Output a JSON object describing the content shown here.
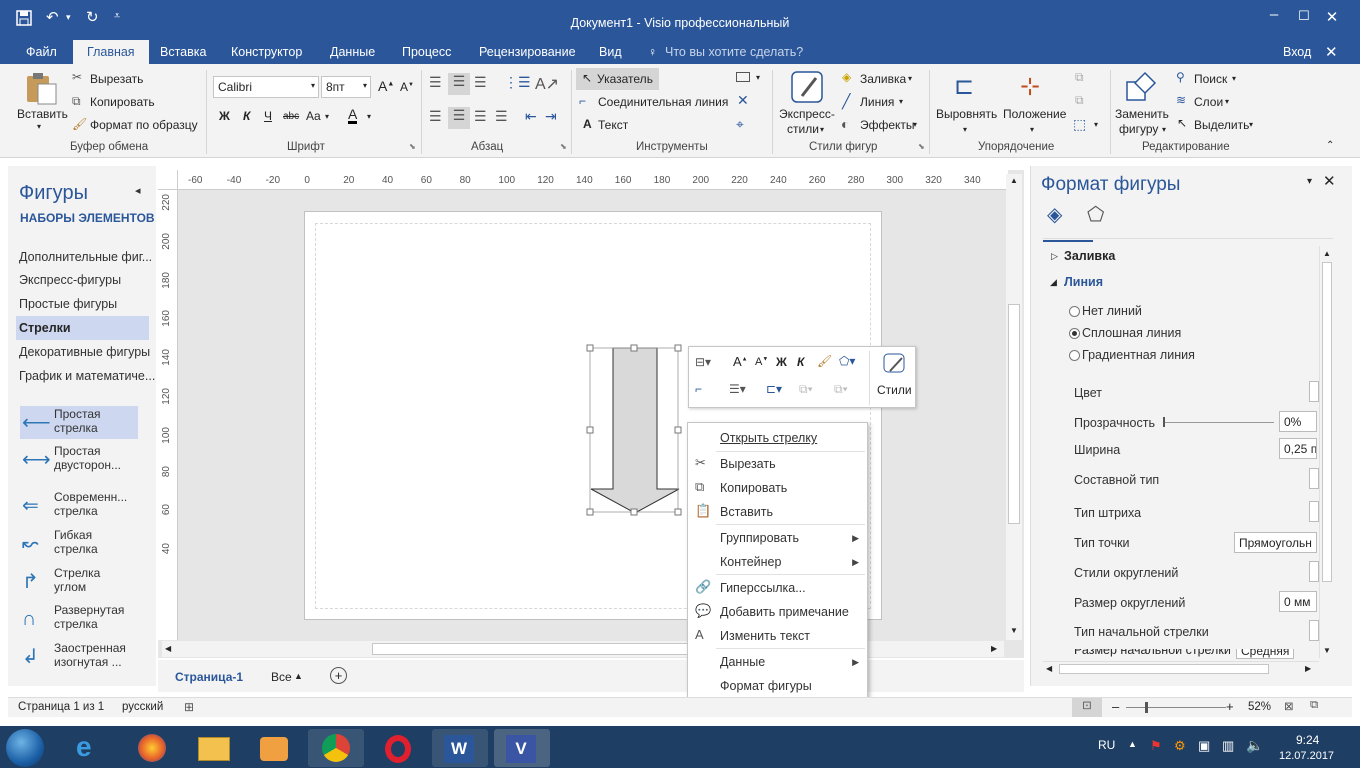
{
  "window": {
    "title": "Документ1 - Visio профессиональный",
    "minimize": "–",
    "maximize": "☐",
    "close": "✕"
  },
  "quick_access": {
    "save": "save-icon",
    "undo": "undo-icon",
    "redo": "redo-icon",
    "customize": "customize-icon"
  },
  "tabs": [
    {
      "label": "Файл"
    },
    {
      "label": "Главная"
    },
    {
      "label": "Вставка"
    },
    {
      "label": "Конструктор"
    },
    {
      "label": "Данные"
    },
    {
      "label": "Процесс"
    },
    {
      "label": "Рецензирование"
    },
    {
      "label": "Вид"
    }
  ],
  "tell_me": "Что вы хотите сделать?",
  "signin": "Вход",
  "ribbon": {
    "clipboard": {
      "paste": "Вставить",
      "cut": "Вырезать",
      "copy": "Копировать",
      "format_painter": "Формат по образцу",
      "label": "Буфер обмена"
    },
    "font": {
      "name": "Calibri",
      "size": "8пт",
      "bold": "Ж",
      "italic": "К",
      "underline": "Ч",
      "strike": "abc",
      "case": "Aa",
      "label": "Шрифт"
    },
    "paragraph": {
      "label": "Абзац"
    },
    "tools": {
      "pointer": "Указатель",
      "connector": "Соединительная линия",
      "text": "Текст",
      "label": "Инструменты"
    },
    "shape_styles": {
      "express": "Экспресс-",
      "express2": "стили",
      "fill": "Заливка",
      "line": "Линия",
      "effects": "Эффекты",
      "label": "Стили фигур"
    },
    "arrange": {
      "align": "Выровнять",
      "position": "Положение",
      "label": "Упорядочение"
    },
    "editing": {
      "replace": "Заменить",
      "replace2": "фигуру",
      "find": "Поиск",
      "layers": "Слои",
      "select": "Выделить",
      "label": "Редактирование"
    }
  },
  "shapes_pane": {
    "title": "Фигуры",
    "sets_header": "НАБОРЫ ЭЛЕМЕНТОВ",
    "items": [
      {
        "label": "Дополнительные фиг..."
      },
      {
        "label": "Экспресс-фигуры"
      },
      {
        "label": "Простые фигуры"
      },
      {
        "label": "Стрелки"
      },
      {
        "label": "Декоративные фигуры"
      },
      {
        "label": "График и математиче..."
      }
    ],
    "stencils": [
      {
        "l1": "Простая",
        "l2": "стрелка",
        "icon": "arrow-left-icon"
      },
      {
        "l1": "Простая",
        "l2": "двусторон...",
        "icon": "arrow-both-icon"
      },
      {
        "l1": "Современн...",
        "l2": "стрелка",
        "icon": "arrow-modern-icon"
      },
      {
        "l1": "Гибкая",
        "l2": "стрелка",
        "icon": "arrow-flex-icon"
      },
      {
        "l1": "Стрелка",
        "l2": "углом",
        "icon": "arrow-corner-icon"
      },
      {
        "l1": "Развернутая",
        "l2": "стрелка",
        "icon": "arrow-uturn-icon"
      },
      {
        "l1": "Заостренная",
        "l2": "изогнутая ...",
        "icon": "arrow-bent-icon"
      }
    ]
  },
  "ruler_h": [
    "-60",
    "-40",
    "-20",
    "0",
    "20",
    "40",
    "60",
    "80",
    "100",
    "120",
    "140",
    "160",
    "180",
    "200",
    "220",
    "240",
    "260",
    "280",
    "300",
    "320",
    "340"
  ],
  "ruler_v": [
    "220",
    "200",
    "180",
    "160",
    "140",
    "120",
    "100",
    "80",
    "60",
    "40"
  ],
  "page_tabs": {
    "page": "Страница-1",
    "all": "Все"
  },
  "mini_toolbar": {
    "styles": "Стили"
  },
  "context_menu": [
    {
      "label": "Открыть стрелку",
      "icon": ""
    },
    {
      "label": "Вырезать",
      "icon": "scissors-icon"
    },
    {
      "label": "Копировать",
      "icon": "copy-icon"
    },
    {
      "label": "Вставить",
      "icon": "paste-icon"
    },
    {
      "label": "Группировать",
      "icon": "",
      "sub": true
    },
    {
      "label": "Контейнер",
      "icon": "",
      "sub": true
    },
    {
      "label": "Гиперссылка...",
      "icon": "link-icon"
    },
    {
      "label": "Добавить примечание",
      "icon": "comment-icon"
    },
    {
      "label": "Изменить текст",
      "icon": "text-icon"
    },
    {
      "label": "Данные",
      "icon": "",
      "sub": true
    },
    {
      "label": "Формат фигуры",
      "icon": ""
    }
  ],
  "format_pane": {
    "title": "Формат фигуры",
    "fill": "Заливка",
    "line": "Линия",
    "no_line": "Нет линий",
    "solid_line": "Сплошная линия",
    "gradient_line": "Градиентная линия",
    "color": "Цвет",
    "transparency": "Прозрачность",
    "transparency_value": "0%",
    "width": "Ширина",
    "width_value": "0,25 п",
    "compound": "Составной тип",
    "dash": "Тип штриха",
    "cap": "Тип точки",
    "cap_value": "Прямоугольн",
    "round_style": "Стили округлений",
    "round_size": "Размер округлений",
    "round_size_value": "0 мм",
    "begin_arrow": "Тип начальной стрелки",
    "begin_size": "Размер начальной стрелки",
    "begin_size_value": "Средняя"
  },
  "status": {
    "page": "Страница 1 из 1",
    "lang": "русский",
    "zoom": "52%"
  },
  "taskbar": {
    "lang": "RU",
    "time": "9:24",
    "date": "12.07.2017"
  },
  "colors": {
    "accent": "#2b579a",
    "selection": "#cdd7f0",
    "arrow": "#2e75b6"
  }
}
